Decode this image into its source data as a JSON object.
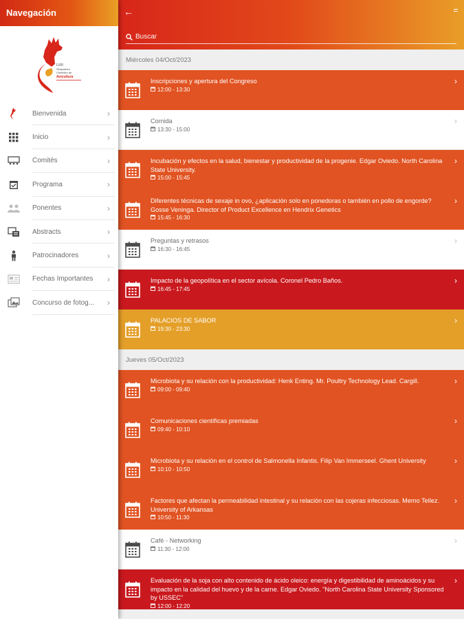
{
  "sidebar": {
    "title": "Navegación",
    "logo_text": [
      "LVIII",
      "Simposium",
      "Científico de",
      "Avicultura"
    ],
    "items": [
      {
        "label": "Bienvenida",
        "icon": "rooster-logo-icon"
      },
      {
        "label": "Inicio",
        "icon": "grid-icon"
      },
      {
        "label": "Comités",
        "icon": "committee-icon"
      },
      {
        "label": "Programa",
        "icon": "calendar-check-icon"
      },
      {
        "label": "Ponentes",
        "icon": "people-icon"
      },
      {
        "label": "Abstracts",
        "icon": "abstracts-icon"
      },
      {
        "label": "Patrocinadores",
        "icon": "person-icon"
      },
      {
        "label": "Fechas Importantes",
        "icon": "newspaper-icon"
      },
      {
        "label": "Concurso de fotog...",
        "icon": "photos-icon"
      }
    ]
  },
  "header": {
    "search_placeholder": "Buscar"
  },
  "days": [
    {
      "label": "Miércoles 04/Oct/2023",
      "events": [
        {
          "title": "Inscripciones y apertura del Congreso",
          "time": "12:00 - 13:30",
          "style": "orange"
        },
        {
          "title": "Comida",
          "time": "13:30 - 15:00",
          "style": "white"
        },
        {
          "title": "Incubación y efectos en la salud, bienestar y productividad de la progenie. Edgar Oviedo. North Carolina State University.",
          "time": "15:00 - 15:45",
          "style": "orange"
        },
        {
          "title": "Diferentes técnicas de sexaje in ovo, ¿aplicación solo en ponedoras o también en pollo de engorde? Gosse Veninga. Director of Product Excellence en Hendrix Genetics",
          "time": "15:45 - 16:30",
          "style": "orange"
        },
        {
          "title": "Preguntas y retrasos",
          "time": "16:30 - 16:45",
          "style": "white"
        },
        {
          "title": "Impacto de la geopolítica en el sector avícola. Coronel Pedro Baños.",
          "time": "16:45 - 17:45",
          "style": "red"
        },
        {
          "title": "PALACIOS DE SABOR",
          "time": "19:30 - 23:30",
          "style": "gold"
        }
      ]
    },
    {
      "label": "Jueves 05/Oct/2023",
      "events": [
        {
          "title": "Microbiota y su relación con la productividad: Henk Enting. Mr. Poultry Technology Lead. Cargill.",
          "time": "09:00 - 09:40",
          "style": "orange"
        },
        {
          "title": "Comunicaciones científicas premiadas",
          "time": "09:40 - 10:10",
          "style": "orange"
        },
        {
          "title": "Microbiota y su relación en el control de Salmonella Infantis. Filip Van Immerseel. Ghent University",
          "time": "10:10 - 10:50",
          "style": "orange"
        },
        {
          "title": "Factores que afectan la permeabilidad intestinal y su relación con las cojeras infecciosas. Memo Tellez. University of Arkansas",
          "time": "10:50 - 11:30",
          "style": "orange"
        },
        {
          "title": "Café - Networking",
          "time": "11:30 - 12:00",
          "style": "white"
        },
        {
          "title": "Evaluación de la soja con alto contenido de ácido oleico: energía y digestibilidad de aminoácidos y su impacto en la calidad del huevo y de la carne. Edgar Oviedo. \"North Carolina State University Sponsored by USSEC\"",
          "time": "12:00 - 12:20",
          "style": "red"
        }
      ]
    }
  ],
  "colors": {
    "orange": "#e15322",
    "red": "#c9191e",
    "gold": "#e49f29",
    "white": "#ffffff"
  }
}
